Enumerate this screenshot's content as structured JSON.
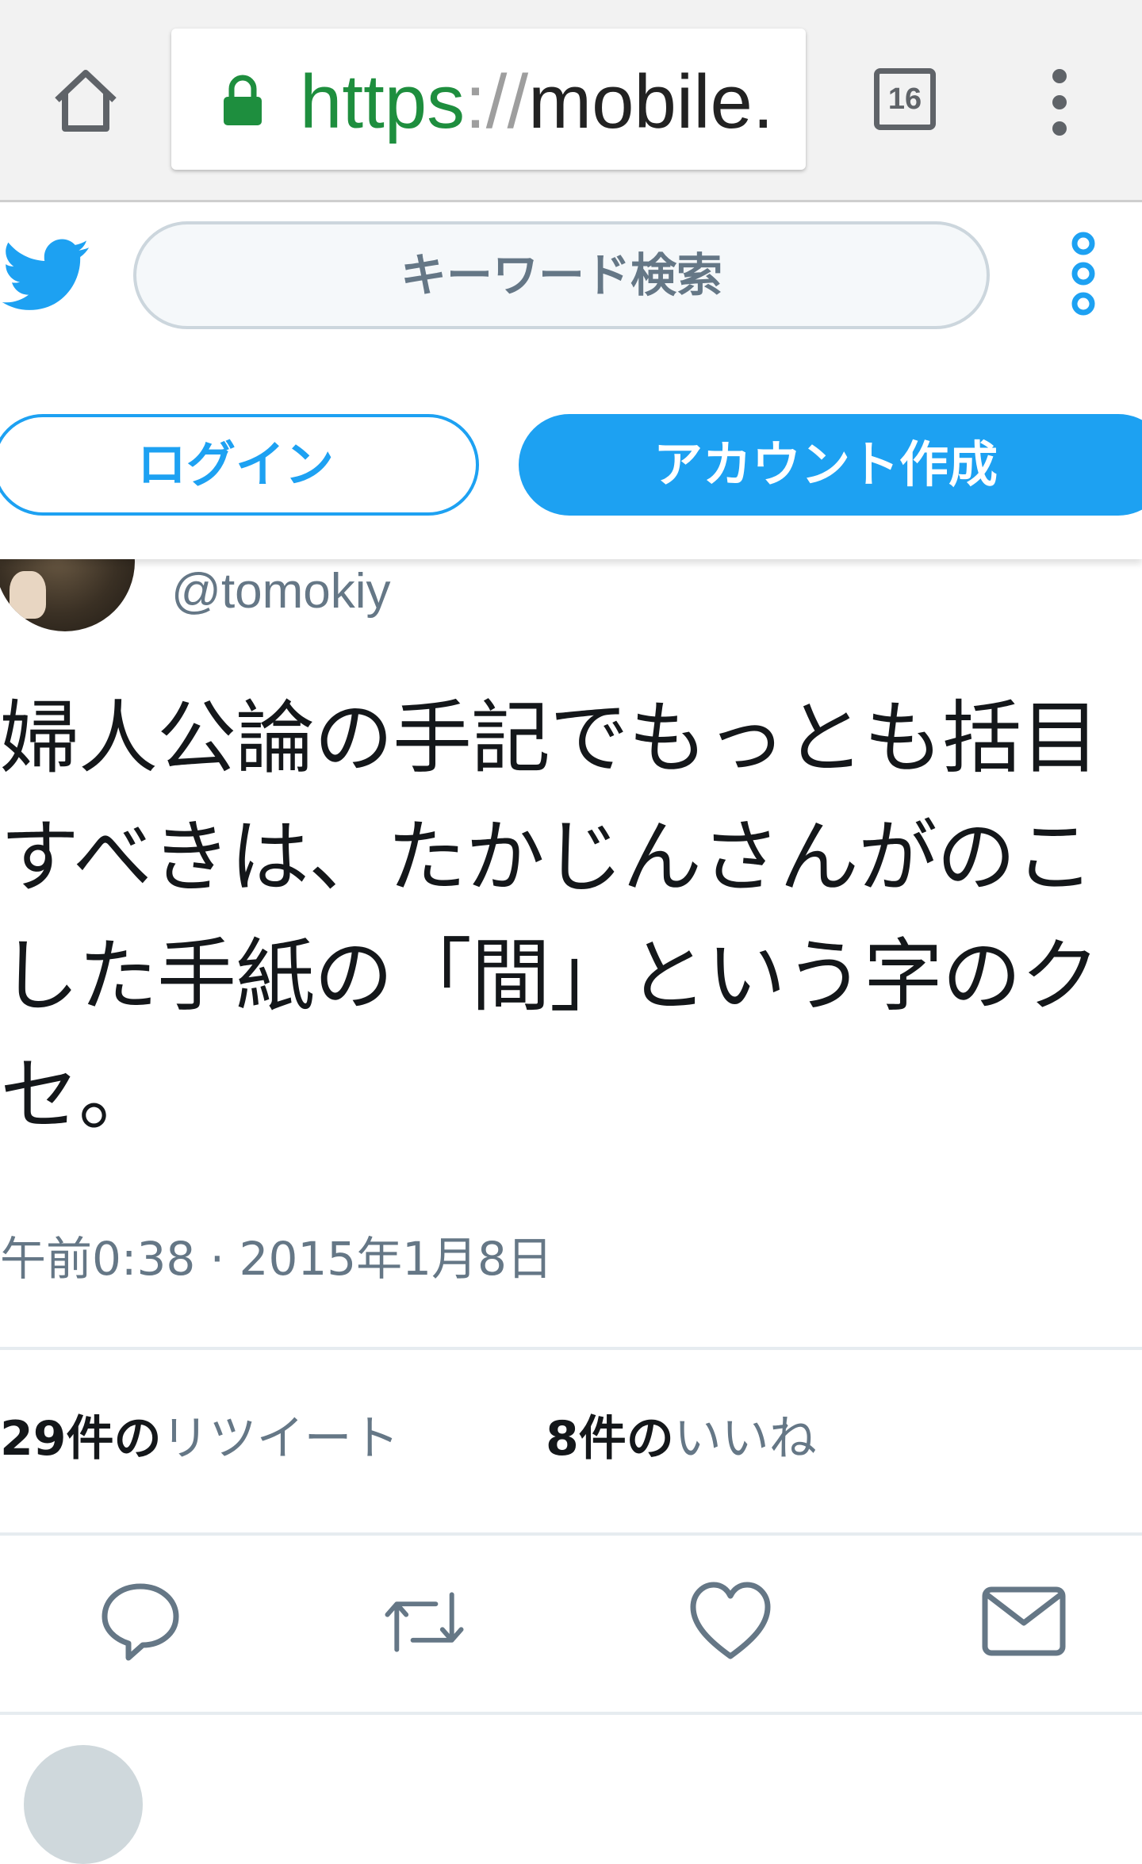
{
  "browser": {
    "url_scheme": "https",
    "url_sep": "://",
    "url_host": "mobile.",
    "tab_count": "16",
    "icons": {
      "home": "home-icon",
      "lock": "lock-icon",
      "tabs": "tabs-icon",
      "menu": "more-vert-icon"
    },
    "lock_color": "#1e8e3e"
  },
  "header": {
    "search_placeholder": "キーワード検索",
    "login_label": "ログイン",
    "signup_label": "アカウント作成",
    "accent": "#1da1f2",
    "icons": {
      "logo": "twitter-bird-icon",
      "more": "more-vert-icon"
    }
  },
  "tweet": {
    "handle": "@tomokiy",
    "text_lines": [
      "婦人公論の手記でもっとも括目",
      "すべきは、たかじんさんがのこ",
      "した手紙の「間」という字のク",
      "セ。"
    ],
    "timestamp": "午前0:38 · 2015年1月8日",
    "retweets": {
      "count": "29件の",
      "label": "リツイート"
    },
    "likes": {
      "count": "8件の",
      "label": "いいね"
    },
    "actions": [
      "reply-icon",
      "retweet-icon",
      "like-icon",
      "dm-icon"
    ]
  }
}
